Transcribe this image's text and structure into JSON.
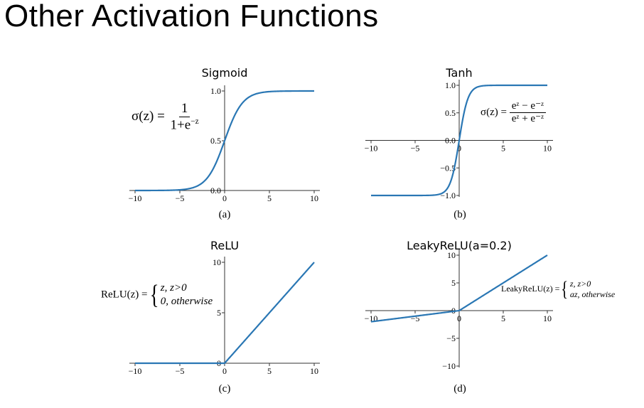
{
  "slide_title": "Other Activation Functions",
  "chart_data": [
    {
      "type": "line",
      "title": "Sigmoid",
      "caption": "(a)",
      "xlim": [
        -10,
        10
      ],
      "ylim": [
        0,
        1
      ],
      "xticks": [
        -10,
        -5,
        0,
        5,
        10
      ],
      "yticks": [
        0.0,
        0.5,
        1.0
      ],
      "xtick_labels": [
        "−10",
        "−5",
        "0",
        "5",
        "10"
      ],
      "ytick_labels": [
        "0.0",
        "0.5",
        "1.0"
      ],
      "function": "sigmoid",
      "x": [
        -10,
        -8,
        -6,
        -5,
        -4,
        -3,
        -2,
        -1,
        0,
        1,
        2,
        3,
        4,
        5,
        6,
        8,
        10
      ],
      "y": [
        4.54e-05,
        0.000335,
        0.00247,
        0.00669,
        0.018,
        0.0474,
        0.119,
        0.269,
        0.5,
        0.731,
        0.881,
        0.953,
        0.982,
        0.993,
        0.998,
        0.9997,
        0.99995
      ],
      "formula": {
        "lhs": "σ(z) =",
        "num": "1",
        "den_base": "1+e",
        "den_sup": "−z"
      },
      "color": "#2a77b4"
    },
    {
      "type": "line",
      "title": "Tanh",
      "caption": "(b)",
      "xlim": [
        -10,
        10
      ],
      "ylim": [
        -1,
        1
      ],
      "xticks": [
        -10,
        -5,
        0,
        5,
        10
      ],
      "yticks": [
        -1.0,
        -0.5,
        0.0,
        0.5,
        1.0
      ],
      "xtick_labels": [
        "−10",
        "−5",
        "0",
        "5",
        "10"
      ],
      "ytick_labels": [
        "−1.0",
        "−0.5",
        "0.0",
        "0.5",
        "1.0"
      ],
      "function": "tanh",
      "x": [
        -10,
        -5,
        -3,
        -2,
        -1,
        -0.5,
        0,
        0.5,
        1,
        2,
        3,
        5,
        10
      ],
      "y": [
        -1.0,
        -0.9999,
        -0.995,
        -0.964,
        -0.762,
        -0.462,
        0.0,
        0.462,
        0.762,
        0.964,
        0.995,
        0.9999,
        1.0
      ],
      "formula": {
        "lhs": "σ(z) =",
        "num": "eᶻ − e⁻ᶻ",
        "den": "eᶻ + e⁻ᶻ"
      },
      "color": "#2a77b4"
    },
    {
      "type": "line",
      "title": "ReLU",
      "caption": "(c)",
      "xlim": [
        -10,
        10
      ],
      "ylim": [
        0,
        10
      ],
      "xticks": [
        -10,
        -5,
        0,
        5,
        10
      ],
      "yticks": [
        0,
        5,
        10
      ],
      "xtick_labels": [
        "−10",
        "−5",
        "0",
        "5",
        "10"
      ],
      "ytick_labels": [
        "0",
        "5",
        "10"
      ],
      "function": "relu",
      "x": [
        -10,
        0,
        10
      ],
      "y": [
        0,
        0,
        10
      ],
      "formula": {
        "lhs": "ReLU(z) =",
        "case1": "z, z>0",
        "case2": "0, otherwise"
      },
      "color": "#2a77b4"
    },
    {
      "type": "line",
      "title": "LeakyReLU(a=0.2)",
      "caption": "(d)",
      "xlim": [
        -10,
        10
      ],
      "ylim": [
        -10,
        10
      ],
      "xticks": [
        -10,
        -5,
        0,
        5,
        10
      ],
      "yticks": [
        -10,
        -5,
        0,
        5,
        10
      ],
      "xtick_labels": [
        "−10",
        "−5",
        "0",
        "5",
        "10"
      ],
      "ytick_labels": [
        "−10",
        "−5",
        "0",
        "5",
        "10"
      ],
      "function": "leaky_relu",
      "x": [
        -10,
        0,
        10
      ],
      "y": [
        -2,
        0,
        10
      ],
      "formula": {
        "lhs": "LeakyReLU(z) =",
        "case1": "z, z>0",
        "case2": "az, otherwise"
      },
      "color": "#2a77b4"
    }
  ]
}
